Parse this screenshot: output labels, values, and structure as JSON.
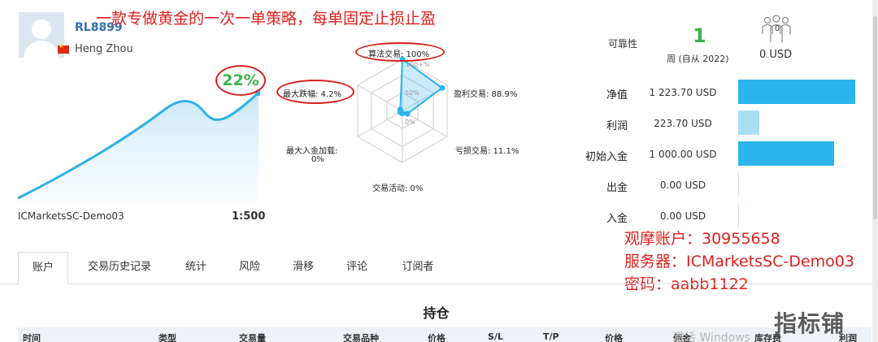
{
  "profile": {
    "username": "RL8899",
    "location": "Heng Zhou",
    "growth": "22%",
    "server": "ICMarketsSC-Demo03",
    "leverage": "1:500"
  },
  "annotations": {
    "title": "一款专做黄金的一次一单策略，每单固定止损止盈",
    "account": "观摩账户：30955658",
    "server": "服务器：ICMarketsSC-Demo03",
    "password": "密码：aabb1122"
  },
  "radar": {
    "algo_trading": "算法交易: 100%",
    "profit_trades": "盈利交易: 88.9%",
    "loss_trades": "亏损交易: 11.1%",
    "activity": "交易活动: 0%",
    "max_deposit_load": "最大入金加载:",
    "max_deposit_load_value": "0%",
    "max_drawdown": "最大跌幅: 4.2%",
    "tick_100": "100+%",
    "tick_50": "50%",
    "tick_0": "0%",
    "values": {
      "algo_trading": 1.0,
      "profit_trades": 0.889,
      "loss_trades": 0.111,
      "activity": 0.0,
      "max_deposit_load": 0.0,
      "max_drawdown": 0.042
    }
  },
  "reliability": {
    "label": "可靠性",
    "value": "1",
    "weeks": "周 (自从 2022)"
  },
  "subscription": {
    "subscribers": "0",
    "price": "0 USD"
  },
  "stats": [
    {
      "label": "净值",
      "value": "1 223.70 USD",
      "fill": 1.0,
      "color": "#2bb5ec"
    },
    {
      "label": "利润",
      "value": "223.70 USD",
      "fill": 0.18,
      "color": "#a9dff6"
    },
    {
      "label": "初始入金",
      "value": "1 000.00 USD",
      "fill": 0.817,
      "color": "#2bb5ec"
    },
    {
      "label": "出金",
      "value": "0.00 USD",
      "fill": 0,
      "color": "#2bb5ec"
    },
    {
      "label": "入金",
      "value": "0.00 USD",
      "fill": 0,
      "color": "#2bb5ec"
    }
  ],
  "tabs": [
    "账户",
    "交易历史记录",
    "统计",
    "风险",
    "滑移",
    "评论",
    "订阅者"
  ],
  "positions": {
    "title": "持仓",
    "columns": [
      "时间",
      "类型",
      "交易量",
      "交易品种",
      "价格",
      "S/L",
      "T/P",
      "价格",
      "佣金",
      "库存费",
      "利润"
    ]
  },
  "watermark": "激活 Windows",
  "logo": "指标铺"
}
